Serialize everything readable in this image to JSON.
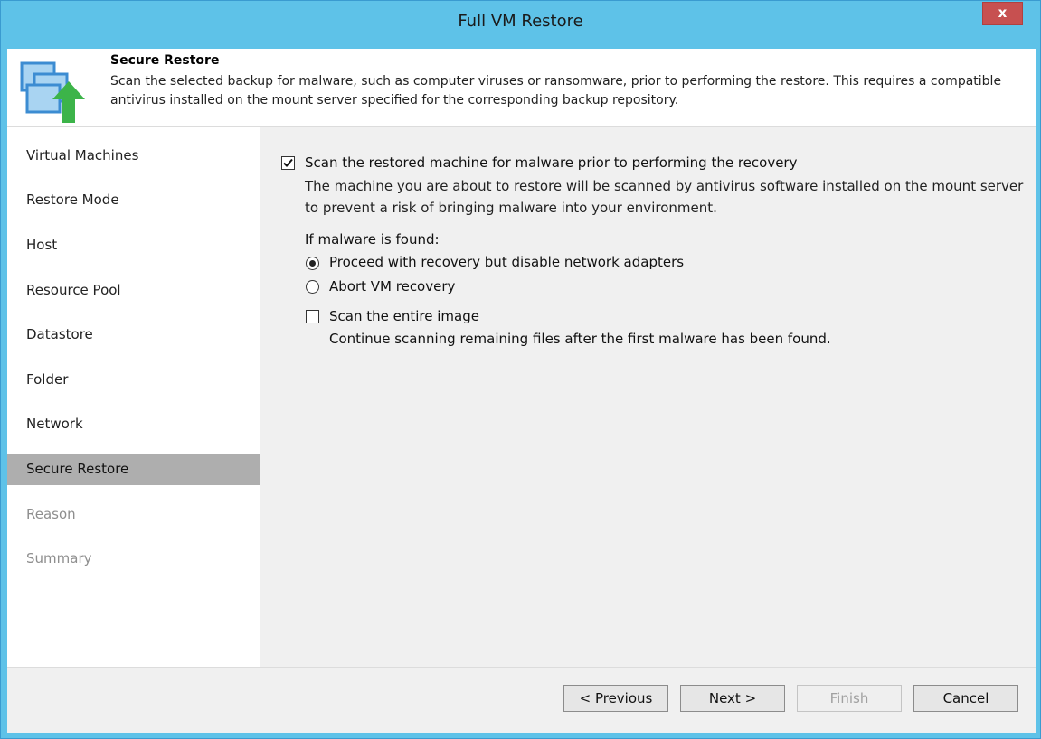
{
  "window": {
    "title": "Full VM Restore",
    "close_label": "x"
  },
  "header": {
    "title": "Secure Restore",
    "description": "Scan the selected backup for malware, such as computer viruses or ransomware, prior to performing the restore. This requires a compatible antivirus installed on the mount server specified for the corresponding backup repository."
  },
  "sidebar": {
    "items": [
      {
        "label": "Virtual Machines",
        "state": "normal"
      },
      {
        "label": "Restore Mode",
        "state": "normal"
      },
      {
        "label": "Host",
        "state": "normal"
      },
      {
        "label": "Resource Pool",
        "state": "normal"
      },
      {
        "label": "Datastore",
        "state": "normal"
      },
      {
        "label": "Folder",
        "state": "normal"
      },
      {
        "label": "Network",
        "state": "normal"
      },
      {
        "label": "Secure Restore",
        "state": "active"
      },
      {
        "label": "Reason",
        "state": "disabled"
      },
      {
        "label": "Summary",
        "state": "disabled"
      }
    ]
  },
  "content": {
    "scan_checkbox": {
      "label": "Scan the restored machine for malware prior to performing the recovery",
      "checked": true
    },
    "scan_description": "The machine you are about to restore will be scanned by antivirus software installed on the mount server to prevent a risk of bringing malware into your environment.",
    "malware_found_label": "If malware is found:",
    "radio_options": [
      {
        "label": "Proceed with recovery but disable network adapters",
        "selected": true
      },
      {
        "label": "Abort VM recovery",
        "selected": false
      }
    ],
    "entire_image_checkbox": {
      "label": "Scan the entire image",
      "checked": false
    },
    "entire_image_description": "Continue scanning remaining files after the first malware has been found."
  },
  "footer": {
    "previous_label": "< Previous",
    "next_label": "Next >",
    "finish_label": "Finish",
    "cancel_label": "Cancel"
  },
  "colors": {
    "title_bar": "#5ec2e8",
    "close_button": "#c75050",
    "active_nav": "#aeaeae",
    "icon_blue": "#3c8cd2",
    "icon_green": "#3cb449"
  }
}
